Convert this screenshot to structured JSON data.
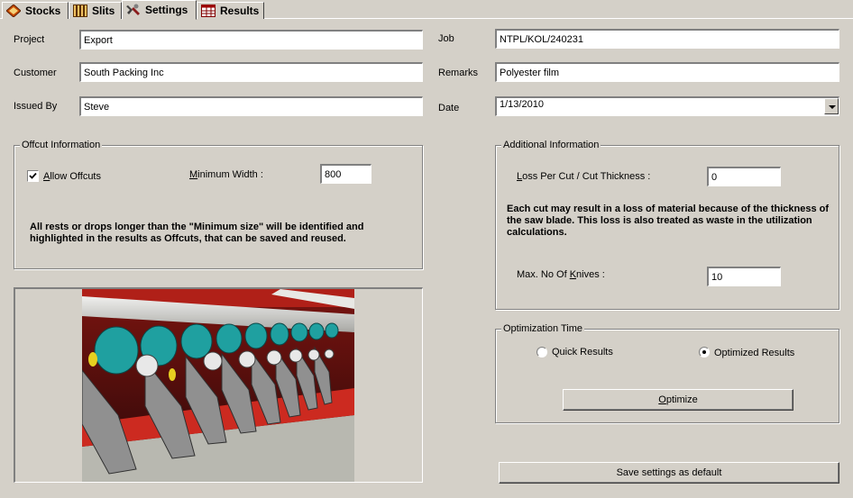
{
  "tabs": [
    {
      "label": "Stocks",
      "icon": "stocks-icon",
      "active": false
    },
    {
      "label": "Slits",
      "icon": "slits-icon",
      "active": false
    },
    {
      "label": "Settings",
      "icon": "settings-icon",
      "active": true
    },
    {
      "label": "Results",
      "icon": "results-icon",
      "active": false
    }
  ],
  "form": {
    "project_label": "Project",
    "project_value": "Export",
    "customer_label": "Customer",
    "customer_value": "South Packing Inc",
    "issued_by_label": "Issued By",
    "issued_by_value": "Steve",
    "job_label": "Job",
    "job_value": "NTPL/KOL/240231",
    "remarks_label": "Remarks",
    "remarks_value": "Polyester film",
    "date_label": "Date",
    "date_value": "1/13/2010"
  },
  "offcut": {
    "title": "Offcut Information",
    "allow_label_ul": "A",
    "allow_label_rest": "llow Offcuts",
    "allow_checked": true,
    "min_width_label_ul": "M",
    "min_width_label_rest": "inimum Width :",
    "min_width_value": "800",
    "note": "All rests or drops longer than the \"Minimum size\" will be identified and highlighted in the results as Offcuts, that can be saved and reused."
  },
  "additional": {
    "title": "Additional Information",
    "loss_label_ul": "L",
    "loss_label_rest": "oss Per Cut / Cut Thickness :",
    "loss_value": "0",
    "note": "Each cut may result in a loss of material because of the thickness of the saw blade. This loss is also treated as waste in the utilization calculations.",
    "knives_label_pre": "Max. No Of ",
    "knives_label_ul": "K",
    "knives_label_rest": "nives :",
    "knives_value": "10"
  },
  "optimization": {
    "title": "Optimization Time",
    "quick_label": "Quick Results",
    "optimized_label": "Optimized Results",
    "selected": "optimized",
    "optimize_button_ul": "O",
    "optimize_button_rest": "ptimize"
  },
  "save_button_label": "Save settings as default",
  "image_name": "slitting-machine-photo"
}
